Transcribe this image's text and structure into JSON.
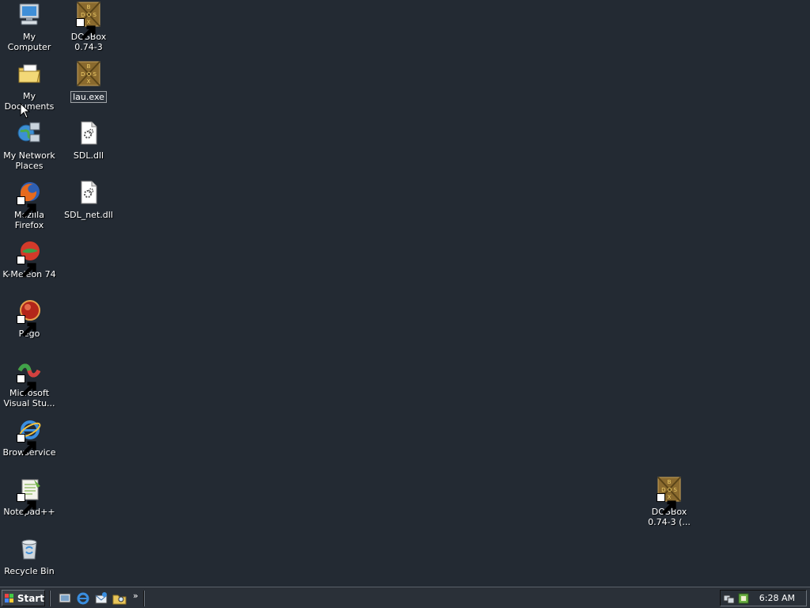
{
  "desktop": {
    "icons": {
      "my_computer": {
        "label": "My Computer"
      },
      "my_documents": {
        "label": "My Documents"
      },
      "my_network": {
        "label": "My Network Places"
      },
      "firefox": {
        "label": "Mozilla Firefox"
      },
      "kmeleon": {
        "label": "K-Meleon 74"
      },
      "pego": {
        "label": "Pego"
      },
      "visual_studio": {
        "label": "Microsoft Visual Stu..."
      },
      "browservice": {
        "label": "Browservice"
      },
      "notepadpp": {
        "label": "Notepad++"
      },
      "recycle_bin": {
        "label": "Recycle Bin"
      },
      "dosbox": {
        "label": "DOSBox 0.74-3"
      },
      "lau_exe": {
        "label": "lau.exe"
      },
      "sdl_dll": {
        "label": "SDL.dll"
      },
      "sdl_net_dll": {
        "label": "SDL_net.dll"
      },
      "dosbox_copy": {
        "label": "DOSBox 0.74-3 (..."
      }
    }
  },
  "taskbar": {
    "start_label": "Start",
    "quick_launch": [
      "show-desktop-icon",
      "internet-explorer-icon",
      "outlook-express-icon",
      "windows-explorer-icon"
    ],
    "overflow": "»",
    "clock": "6:28 AM"
  },
  "colors": {
    "desktop_bg": "#232a33",
    "taskbar_bg": "#2a3038",
    "label": "#ffffff"
  }
}
